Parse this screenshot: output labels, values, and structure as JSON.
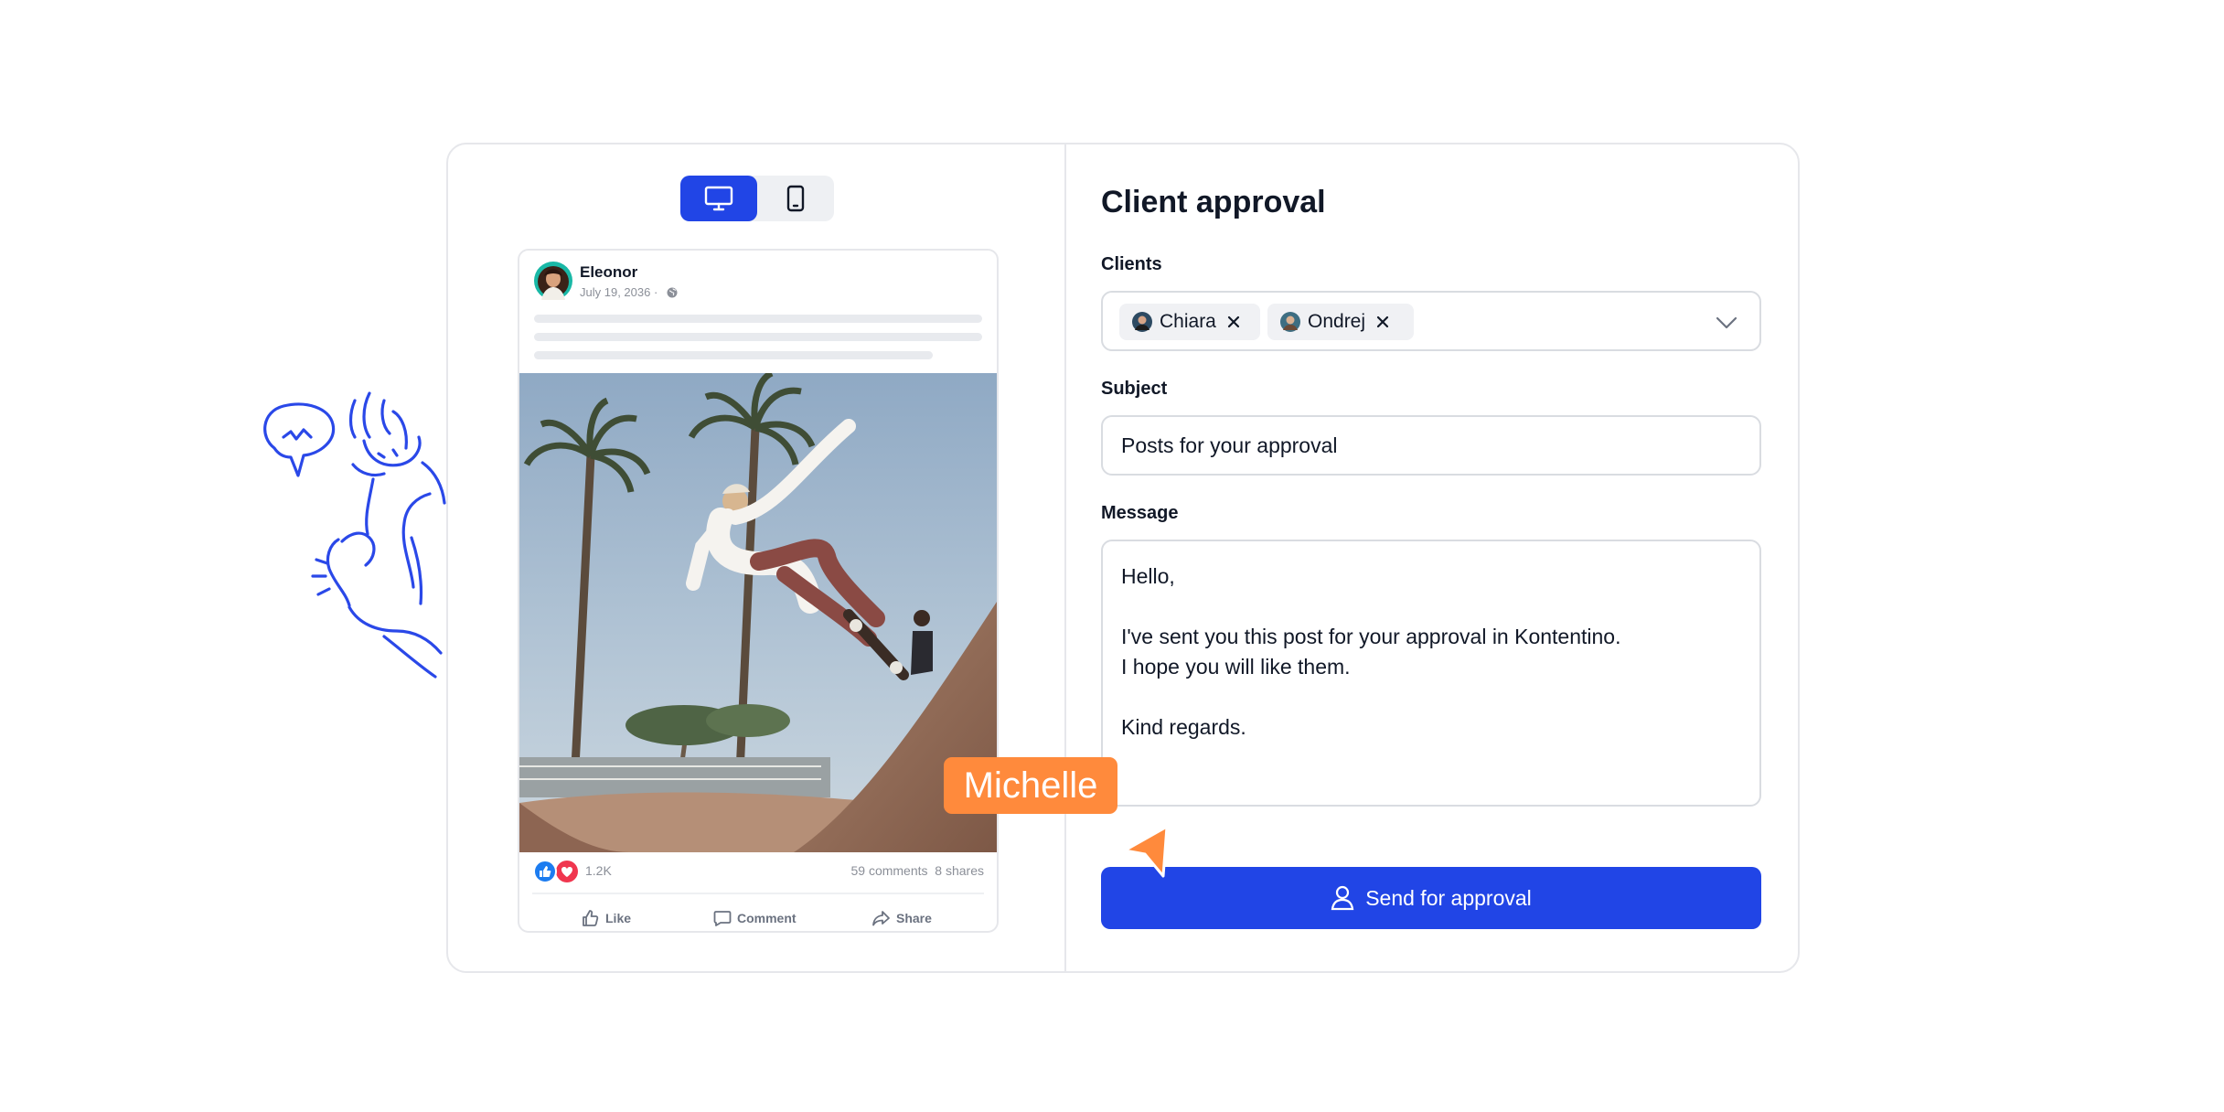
{
  "preview": {
    "toggle": {
      "desktop_icon": "desktop-icon",
      "mobile_icon": "mobile-icon",
      "active": "desktop"
    },
    "post": {
      "author": "Eleonor",
      "date": "July 19, 2036",
      "date_separator": "·",
      "reactions_count": "1.2K",
      "stats": "59 comments  8 shares",
      "actions": {
        "like": "Like",
        "comment": "Comment",
        "share": "Share"
      }
    }
  },
  "approval": {
    "title": "Client approval",
    "clients": {
      "label": "Clients",
      "selected": [
        {
          "name": "Chiara"
        },
        {
          "name": "Ondrej"
        }
      ]
    },
    "subject": {
      "label": "Subject",
      "value": "Posts for your approval"
    },
    "message": {
      "label": "Message",
      "value": "Hello,\n\nI've sent you this post for your approval in Kontentino.\nI hope you will like them.\n\nKind regards."
    },
    "send_button": "Send for approval"
  },
  "collaborator_cursor": {
    "name": "Michelle",
    "color": "#ff8a3c"
  },
  "colors": {
    "primary": "#2145e6",
    "doodle": "#2a48e8",
    "border": "#e6e7eb"
  }
}
